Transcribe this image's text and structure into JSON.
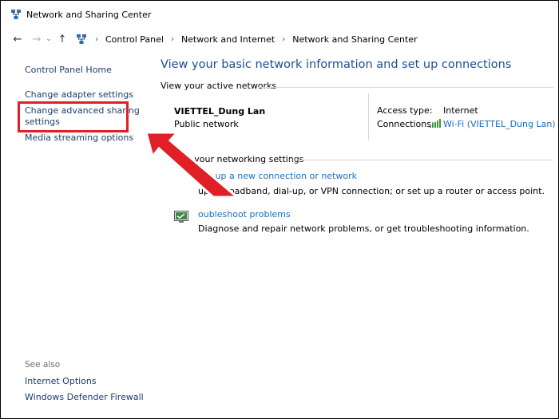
{
  "window": {
    "title": "Network and Sharing Center"
  },
  "address": {
    "crumbs": [
      "Control Panel",
      "Network and Internet",
      "Network and Sharing Center"
    ]
  },
  "sidebar": {
    "home": "Control Panel Home",
    "links": [
      "Change adapter settings",
      "Change advanced sharing settings",
      "Media streaming options"
    ],
    "link2_lines": [
      "Change advanced sharing",
      "settings"
    ],
    "see_also_label": "See also",
    "see_also": [
      "Internet Options",
      "Windows Defender Firewall"
    ]
  },
  "main": {
    "heading": "View your basic network information and set up connections",
    "active_label": "View your active networks",
    "network": {
      "name": "VIETTEL_Dung Lan",
      "category": "Public network",
      "access_label": "Access type:",
      "access_value": "Internet",
      "connections_label": "Connections:",
      "connections_value": "Wi-Fi (VIETTEL_Dung Lan)"
    },
    "change_label": "ge your networking settings",
    "tasks": [
      {
        "link": "Set up a new connection or network",
        "desc": "up a broadband, dial-up, or VPN connection; or set up a router or access point."
      },
      {
        "link": "oubleshoot problems",
        "desc": "Diagnose and repair network problems, or get troubleshooting information."
      }
    ]
  },
  "colors": {
    "heading": "#1d4e92",
    "link": "#1a6fc1",
    "highlight": "#e01f26",
    "arrow": "#e01f26"
  },
  "icons": [
    "network-center-icon",
    "back-arrow-icon",
    "forward-arrow-icon",
    "chevron-down-icon",
    "up-arrow-icon",
    "wifi-signal-icon",
    "troubleshoot-icon",
    "red-annotation-arrow"
  ]
}
